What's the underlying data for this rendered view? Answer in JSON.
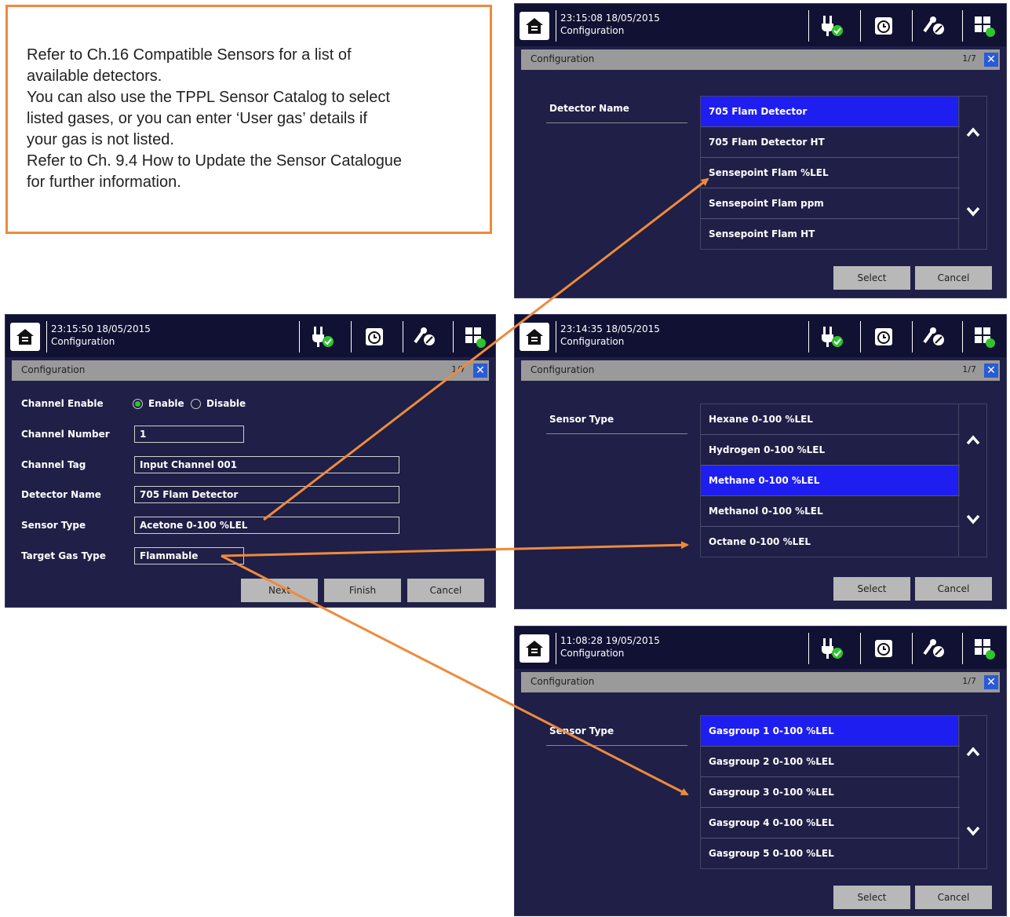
{
  "note": {
    "lines": [
      "Refer to Ch.16 Compatible Sensors for a list of",
      "available detectors.",
      "You can also use the TPPL Sensor Catalog to select",
      "listed gases, or you can enter ‘User gas’ details if",
      "your gas is not listed.",
      "Refer to Ch. 9.4 How to Update the Sensor Catalogue",
      "for further information."
    ]
  },
  "main_form": {
    "time": "23:15:50 18/05/2015",
    "subtitle": "Configuration",
    "title": "Configuration",
    "page": "1/7",
    "channel_enable_label": "Channel Enable",
    "enable_label": "Enable",
    "disable_label": "Disable",
    "channel_number_label": "Channel Number",
    "channel_number_value": "1",
    "channel_tag_label": "Channel Tag",
    "channel_tag_value": "Input Channel 001",
    "detector_name_label": "Detector Name",
    "detector_name_value": "705 Flam Detector",
    "sensor_type_label": "Sensor Type",
    "sensor_type_value": "Acetone 0-100 %LEL",
    "target_gas_label": "Target Gas Type",
    "target_gas_value": "Flammable",
    "next_label": "Next",
    "finish_label": "Finish",
    "cancel_label": "Cancel"
  },
  "detector_screen": {
    "time": "23:15:08 18/05/2015",
    "subtitle": "Configuration",
    "title": "Configuration",
    "page": "1/7",
    "field_label": "Detector Name",
    "items": [
      "705 Flam Detector",
      "705 Flam Detector HT",
      "Sensepoint Flam %LEL",
      "Sensepoint Flam ppm",
      "Sensepoint Flam HT"
    ],
    "select_label": "Select",
    "cancel_label": "Cancel"
  },
  "sensor_screen": {
    "time": "23:14:35 18/05/2015",
    "subtitle": "Configuration",
    "title": "Configuration",
    "page": "1/7",
    "field_label": "Sensor Type",
    "items": [
      "Hexane 0-100 %LEL",
      "Hydrogen 0-100 %LEL",
      "Methane 0-100 %LEL",
      "Methanol 0-100 %LEL",
      "Octane 0-100 %LEL"
    ],
    "select_label": "Select",
    "cancel_label": "Cancel"
  },
  "gasgroup_screen": {
    "time": "11:08:28 19/05/2015",
    "subtitle": "Configuration",
    "title": "Configuration",
    "page": "1/7",
    "field_label": "Sensor Type",
    "items": [
      "Gasgroup 1 0-100 %LEL",
      "Gasgroup 2 0-100 %LEL",
      "Gasgroup 3 0-100 %LEL",
      "Gasgroup 4 0-100 %LEL",
      "Gasgroup 5 0-100 %LEL"
    ],
    "select_label": "Select",
    "cancel_label": "Cancel"
  },
  "colors": {
    "accent_orange": "#ef8a3c",
    "screen_bg": "#1f1f47",
    "selected_row": "#1e1ef0"
  }
}
